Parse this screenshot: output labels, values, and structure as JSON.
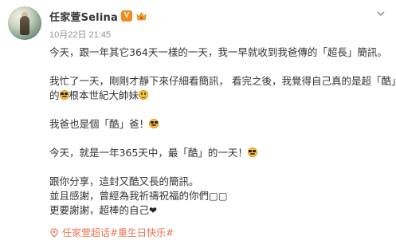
{
  "post": {
    "username": "任家萱Selina",
    "verified_label": "V",
    "timestamp": "10月22日 21:45",
    "lines": [
      "今天，跟一年其它364天一樣的一天，我一早就收到我爸傳的「超長」簡訊。",
      "我忙了一天，剛剛才靜下來仔細看簡訊， 看完之後，我覺得自己真的是超「酷」",
      "的",
      "根本世紀大帥妹",
      "我爸也是個「酷」爸！",
      "今天，就是一年365天中，最「酷」的一天！",
      "跟你分享，這封又酷又長的簡訊。",
      "並且感謝，曾經為我祈禱祝福的你們",
      "更要謝謝，超棒的自己"
    ],
    "small_squares": "▢▢",
    "heart_glyph": "❤",
    "topic_text": "任家萱超话#重生日快乐#"
  },
  "icons": {
    "menu": "chevron-down-icon",
    "topic": "location-pin-icon",
    "vip": "vip-badge-icon"
  },
  "colors": {
    "accent": "#eb7350",
    "verified": "#f28a1c",
    "timestamp": "#939393",
    "text": "#333333"
  }
}
